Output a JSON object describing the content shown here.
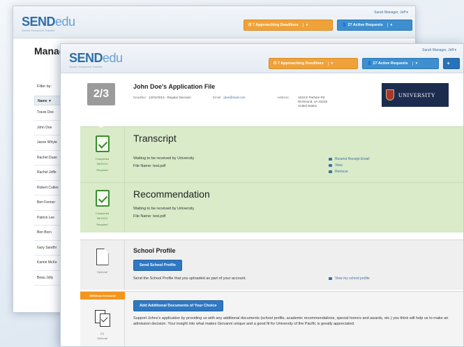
{
  "brand": {
    "name_bold": "SEND",
    "name_light": "edu",
    "tagline": "Secure Document Transfer"
  },
  "back_window": {
    "user_menu": "Sarah Manager, Jeff ▾",
    "deadlines_btn": "7 Approaching Deadlines",
    "requests_btn": "27 Active Requests",
    "page_title": "Manag",
    "filter_label": "Filter by:",
    "table_header": "Name ▼",
    "names": [
      "Travis Doe",
      "John Doe",
      "Jason Whyte",
      "Rachel Duan",
      "Rachel Jeffe",
      "Robert Cullen",
      "Ben Fenner",
      "Patrick Lee",
      "Ben Born",
      "Gary Sandhi",
      "Karine McKe",
      "Beau Jolly"
    ]
  },
  "front_window": {
    "user_menu": "Sarah Manager, Jeff ▾",
    "deadlines_btn": "7 Approaching Deadlines",
    "requests_btn": "27 Active Requests",
    "add_btn": "+👤",
    "count": "2/3",
    "app_title": "John Doe's Application File",
    "deadline_label": "Deadline:",
    "deadline_value": "12/01/2013 - Regular Decision",
    "email_label": "Email:",
    "email_value": "jdoe@mail.com",
    "address_label": "Address:",
    "address_lines": [
      "1610 E Parham Rd",
      "Richmond, VA 23228",
      "United States"
    ],
    "university_name": "UNIVERSITY",
    "transcript": {
      "title": "Transcript",
      "status": "Completed",
      "date": "08/20/13",
      "required": "Required",
      "waiting": "Waiting to be received by University",
      "file": "File Name: test.pdf",
      "actions": [
        "Resend Receipt Email",
        "View",
        "Remove"
      ]
    },
    "recommendation": {
      "title": "Recommendation",
      "status": "Completed",
      "date": "08/19/13",
      "required": "Required",
      "waiting": "Waiting to be received by University",
      "file": "File Name: test.pdf"
    },
    "school_profile": {
      "title": "School Profile",
      "optional": "Optional",
      "button": "Send School Profile",
      "desc": "Send the School Profile that you uploaded as part of your account.",
      "link": "View my school profile"
    },
    "additional": {
      "badge": "SENDedu Exclusive",
      "button": "Add Additional Documents of Your Choice",
      "count": "(0)",
      "optional": "Optional",
      "desc": "Support Johns's application by providing us with any additional documents (school profile, academic recommendations, special honors and awards, etc.) you think will help us to make an admission decision. Your insight into what makes Giovanni unique and a good fit for University of the Pacific is greatly appreciated."
    }
  }
}
